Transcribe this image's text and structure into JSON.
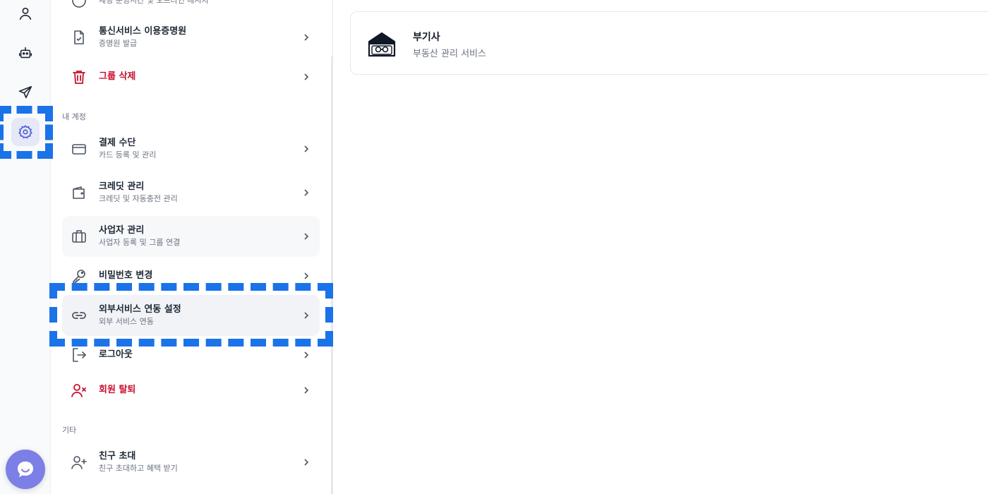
{
  "rail": {
    "icons": [
      "user-icon",
      "robot-icon",
      "send-icon",
      "gear-icon"
    ],
    "chat_icon": "chat-bubble-icon"
  },
  "settings": {
    "top_partial": {
      "title": "",
      "subtitle": "채팅 운영시간 및 오프라인 메시지"
    },
    "items_group": [
      {
        "title": "통신서비스 이용증명원",
        "subtitle": "증명원 발급",
        "icon": "document-check-icon"
      },
      {
        "title": "그룹 삭제",
        "subtitle": "",
        "icon": "trash-icon",
        "danger": true
      }
    ],
    "section_account": "내 계정",
    "items_account": [
      {
        "title": "결제 수단",
        "subtitle": "카드 등록 및 관리",
        "icon": "credit-card-icon"
      },
      {
        "title": "크레딧 관리",
        "subtitle": "크레딧 및 자동충전 관리",
        "icon": "wallet-icon"
      },
      {
        "title": "사업자 관리",
        "subtitle": "사업자 등록 및 그룹 연결",
        "icon": "briefcase-icon"
      },
      {
        "title": "비밀번호 변경",
        "subtitle": "",
        "icon": "key-icon"
      },
      {
        "title": "외부서비스 연동 설정",
        "subtitle": "외부 서비스 연동",
        "icon": "link-icon"
      },
      {
        "title": "로그아웃",
        "subtitle": "",
        "icon": "logout-icon"
      },
      {
        "title": "회원 탈퇴",
        "subtitle": "",
        "icon": "user-remove-icon",
        "danger": true
      }
    ],
    "section_other": "기타",
    "items_other": [
      {
        "title": "친구 초대",
        "subtitle": "친구 초대하고 혜택 받기",
        "icon": "user-add-icon"
      }
    ]
  },
  "content": {
    "service": {
      "title": "부기사",
      "subtitle": "부동산 관리 서비스",
      "logo": "bugisa-logo"
    }
  },
  "colors": {
    "accent": "#1a73e8",
    "danger": "#c8102e",
    "rail_active": "#e4e8f7",
    "fab": "#7c7fe6"
  }
}
